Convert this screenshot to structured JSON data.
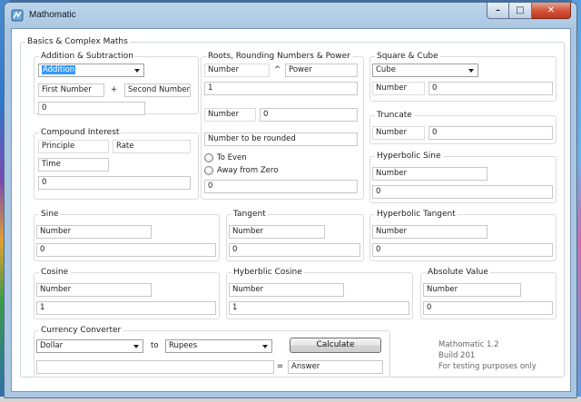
{
  "window": {
    "title": "Mathomatic",
    "min_glyph": "–",
    "max_glyph": "□",
    "close_glyph": "✕"
  },
  "main_group": {
    "title": "Basics & Complex Maths"
  },
  "addition": {
    "title": "Addition & Subtraction",
    "operation": "Addition",
    "first_placeholder": "First Number",
    "operator": "+",
    "second_placeholder": "Second Number",
    "result": "0"
  },
  "compound": {
    "title": "Compound Interest",
    "principle": "Principle",
    "rate": "Rate",
    "time": "Time",
    "result": "0"
  },
  "roots": {
    "title": "Roots, Rounding Numbers & Power",
    "number": "Number",
    "caret": "^",
    "power": "Power",
    "power_result": "1",
    "root_number": "Number",
    "root_result": "0",
    "round_input": "Number to be rounded",
    "to_even": "To Even",
    "away_from_zero": "Away from Zero",
    "round_result": "0"
  },
  "square": {
    "title": "Square & Cube",
    "operation": "Cube",
    "number": "Number",
    "result": "0"
  },
  "truncate": {
    "title": "Truncate",
    "number": "Number",
    "result": "0"
  },
  "hsine": {
    "title": "Hyperbolic Sine",
    "number": "Number",
    "result": "0"
  },
  "sine": {
    "title": "Sine",
    "number": "Number",
    "result": "0"
  },
  "tangent": {
    "title": "Tangent",
    "number": "Number",
    "result": "0"
  },
  "htangent": {
    "title": "Hyperbolic Tangent",
    "number": "Number",
    "result": "0"
  },
  "cosine": {
    "title": "Cosine",
    "number": "Number",
    "result": "1"
  },
  "hcosine": {
    "title": "Hyberblic Cosine",
    "number": "Number",
    "result": "1"
  },
  "absolute": {
    "title": "Absolute Value",
    "number": "Number",
    "result": "0"
  },
  "currency": {
    "title": "Currency Converter",
    "from": "Dollar",
    "to_label": "to",
    "to": "Rupees",
    "calculate": "Calculate",
    "amount": "",
    "equals": "=",
    "answer": "Answer"
  },
  "about": {
    "line1": "Mathomatic 1.2",
    "line2": "Build 201",
    "line3": "For testing purposes only"
  }
}
